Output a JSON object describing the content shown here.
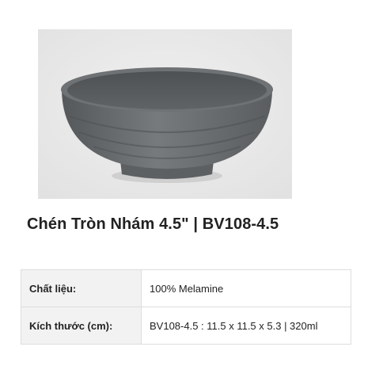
{
  "image": {
    "alt": "bowl-photo"
  },
  "colors": {
    "bowl": "#6b6e70",
    "background": "#eaeaea",
    "table_header": "#f2f2f2",
    "border": "#dddddd"
  },
  "product": {
    "title": "Chén Tròn Nhám 4.5\" | BV108-4.5"
  },
  "specs": [
    {
      "label": "Chất liệu:",
      "value": "100% Melamine"
    },
    {
      "label": "Kích thước (cm):",
      "value": "BV108-4.5 : 11.5 x 11.5 x 5.3 | 320ml"
    }
  ]
}
